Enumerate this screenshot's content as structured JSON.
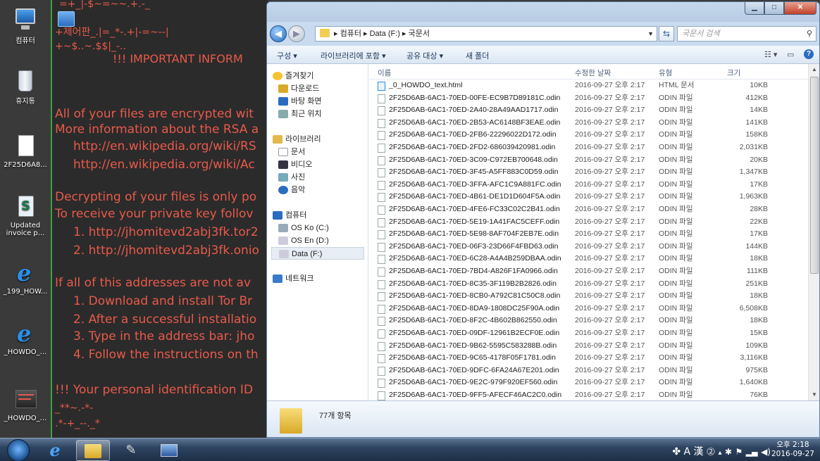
{
  "desktop_icons": [
    {
      "label": "컴퓨터",
      "icon": "computer-icon"
    },
    {
      "label": "휴지통",
      "icon": "recycle-bin-icon"
    },
    {
      "label": "2F25D6A8...",
      "icon": "file-icon"
    },
    {
      "label": "Updated invoice p...",
      "icon": "script-icon"
    },
    {
      "label": "_199_HOW...",
      "icon": "ie-icon"
    },
    {
      "label": "_HOWDO_...",
      "icon": "ie-icon"
    },
    {
      "label": "_HOWDO_...",
      "icon": "image-icon"
    }
  ],
  "ransom_note": {
    "lines": [
      "=+_|-$~=~~.+.-_",
      "+제어판_.|=_*-.+|-=~--|",
      "+~$..~.$$|_-..",
      "!!! IMPORTANT INFORM",
      "All of your files are encrypted wit",
      "More information about the RSA a",
      "http://en.wikipedia.org/wiki/RS",
      "http://en.wikipedia.org/wiki/Ac",
      "Decrypting of your files is only po",
      "To receive your private key follov",
      "1. http://jhomitevd2abj3fk.tor2",
      "2. http://jhomitevd2abj3fk.onio",
      "If all of this addresses are not av",
      "1. Download and install Tor Br",
      "2. After a successful installatio",
      "3. Type in the address bar: jho",
      "4. Follow the instructions on th",
      "!!! Your personal identification ID",
      "_**~.-*-",
      ".*-+_--._*"
    ]
  },
  "explorer": {
    "breadcrumb": "▸ 컴퓨터 ▸ Data (F:) ▸ 국문서",
    "search_placeholder": "국문서 검색",
    "toolbar": {
      "organize": "구성 ▾",
      "include_library": "라이브러리에 포함 ▾",
      "share": "공유 대상 ▾",
      "new_folder": "새 폴더"
    },
    "nav": {
      "favorites": "즐겨찾기",
      "downloads": "다운로드",
      "desktop": "바탕 화면",
      "recent": "최근 위치",
      "libraries": "라이브러리",
      "documents": "문서",
      "videos": "비디오",
      "pictures": "사진",
      "music": "음악",
      "computer": "컴퓨터",
      "drive_c": "OS Ko (C:)",
      "drive_d": "OS En (D:)",
      "drive_f": "Data (F:)",
      "network": "네트워크"
    },
    "columns": {
      "name": "이름",
      "date": "수정한 날짜",
      "type": "유형",
      "size": "크기"
    },
    "files": [
      {
        "name": "_0_HOWDO_text.html",
        "date": "2016-09-27 오후 2:17",
        "type": "HTML 문서",
        "size": "10KB"
      },
      {
        "name": "2F25D6AB-6AC1-70ED-00FE-EC9B7D89181C.odin",
        "date": "2016-09-27 오후 2:17",
        "type": "ODIN 파일",
        "size": "412KB"
      },
      {
        "name": "2F25D6AB-6AC1-70ED-2A40-28A49AAD1717.odin",
        "date": "2016-09-27 오후 2:17",
        "type": "ODIN 파일",
        "size": "14KB"
      },
      {
        "name": "2F25D6AB-6AC1-70ED-2B53-AC6148BF3EAE.odin",
        "date": "2016-09-27 오후 2:17",
        "type": "ODIN 파일",
        "size": "141KB"
      },
      {
        "name": "2F25D6AB-6AC1-70ED-2FB6-22296022D172.odin",
        "date": "2016-09-27 오후 2:17",
        "type": "ODIN 파일",
        "size": "158KB"
      },
      {
        "name": "2F25D6AB-6AC1-70ED-2FD2-686039420981.odin",
        "date": "2016-09-27 오후 2:17",
        "type": "ODIN 파일",
        "size": "2,031KB"
      },
      {
        "name": "2F25D6AB-6AC1-70ED-3C09-C972EB700648.odin",
        "date": "2016-09-27 오후 2:17",
        "type": "ODIN 파일",
        "size": "20KB"
      },
      {
        "name": "2F25D6AB-6AC1-70ED-3F45-A5FF883C0D59.odin",
        "date": "2016-09-27 오후 2:17",
        "type": "ODIN 파일",
        "size": "1,347KB"
      },
      {
        "name": "2F25D6AB-6AC1-70ED-3FFA-AFC1C9A881FC.odin",
        "date": "2016-09-27 오후 2:17",
        "type": "ODIN 파일",
        "size": "17KB"
      },
      {
        "name": "2F25D6AB-6AC1-70ED-4B61-DE1D1D604F5A.odin",
        "date": "2016-09-27 오후 2:17",
        "type": "ODIN 파일",
        "size": "1,963KB"
      },
      {
        "name": "2F25D6AB-6AC1-70ED-4FE6-FC33C02C2B41.odin",
        "date": "2016-09-27 오후 2:17",
        "type": "ODIN 파일",
        "size": "28KB"
      },
      {
        "name": "2F25D6AB-6AC1-70ED-5E19-1A41FAC5CEFF.odin",
        "date": "2016-09-27 오후 2:17",
        "type": "ODIN 파일",
        "size": "22KB"
      },
      {
        "name": "2F25D6AB-6AC1-70ED-5E98-8AF704F2EB7E.odin",
        "date": "2016-09-27 오후 2:17",
        "type": "ODIN 파일",
        "size": "17KB"
      },
      {
        "name": "2F25D6AB-6AC1-70ED-06F3-23D66F4FBD63.odin",
        "date": "2016-09-27 오후 2:17",
        "type": "ODIN 파일",
        "size": "144KB"
      },
      {
        "name": "2F25D6AB-6AC1-70ED-6C28-A4A4B259DBAA.odin",
        "date": "2016-09-27 오후 2:17",
        "type": "ODIN 파일",
        "size": "18KB"
      },
      {
        "name": "2F25D6AB-6AC1-70ED-7BD4-A826F1FA0966.odin",
        "date": "2016-09-27 오후 2:17",
        "type": "ODIN 파일",
        "size": "111KB"
      },
      {
        "name": "2F25D6AB-6AC1-70ED-8C35-3F119B2B2826.odin",
        "date": "2016-09-27 오후 2:17",
        "type": "ODIN 파일",
        "size": "251KB"
      },
      {
        "name": "2F25D6AB-6AC1-70ED-8CB0-A792C81C50C8.odin",
        "date": "2016-09-27 오후 2:17",
        "type": "ODIN 파일",
        "size": "18KB"
      },
      {
        "name": "2F25D6AB-6AC1-70ED-8DA9-1808DC25F90A.odin",
        "date": "2016-09-27 오후 2:17",
        "type": "ODIN 파일",
        "size": "6,508KB"
      },
      {
        "name": "2F25D6AB-6AC1-70ED-8F2C-4B602B862550.odin",
        "date": "2016-09-27 오후 2:17",
        "type": "ODIN 파일",
        "size": "18KB"
      },
      {
        "name": "2F25D6AB-6AC1-70ED-09DF-12961B2ECF0E.odin",
        "date": "2016-09-27 오후 2:17",
        "type": "ODIN 파일",
        "size": "15KB"
      },
      {
        "name": "2F25D6AB-6AC1-70ED-9B62-5595C583288B.odin",
        "date": "2016-09-27 오후 2:17",
        "type": "ODIN 파일",
        "size": "109KB"
      },
      {
        "name": "2F25D6AB-6AC1-70ED-9C65-4178F05F1781.odin",
        "date": "2016-09-27 오후 2:17",
        "type": "ODIN 파일",
        "size": "3,116KB"
      },
      {
        "name": "2F25D6AB-6AC1-70ED-9DFC-6FA24A67E201.odin",
        "date": "2016-09-27 오후 2:17",
        "type": "ODIN 파일",
        "size": "975KB"
      },
      {
        "name": "2F25D6AB-6AC1-70ED-9E2C-979F920EF560.odin",
        "date": "2016-09-27 오후 2:17",
        "type": "ODIN 파일",
        "size": "1,640KB"
      },
      {
        "name": "2F25D6AB-6AC1-70ED-9FF5-AFECF46AC2C0.odin",
        "date": "2016-09-27 오후 2:17",
        "type": "ODIN 파일",
        "size": "76KB"
      }
    ],
    "item_count": "77개 항목"
  },
  "taskbar": {
    "tray_text": "A 漢",
    "time": "오후 2:18",
    "date": "2016-09-27"
  },
  "colors": {
    "ransom_text": "#e85a4a",
    "ransom_bg": "#2b2b2b",
    "accent_green": "#3da33d"
  }
}
